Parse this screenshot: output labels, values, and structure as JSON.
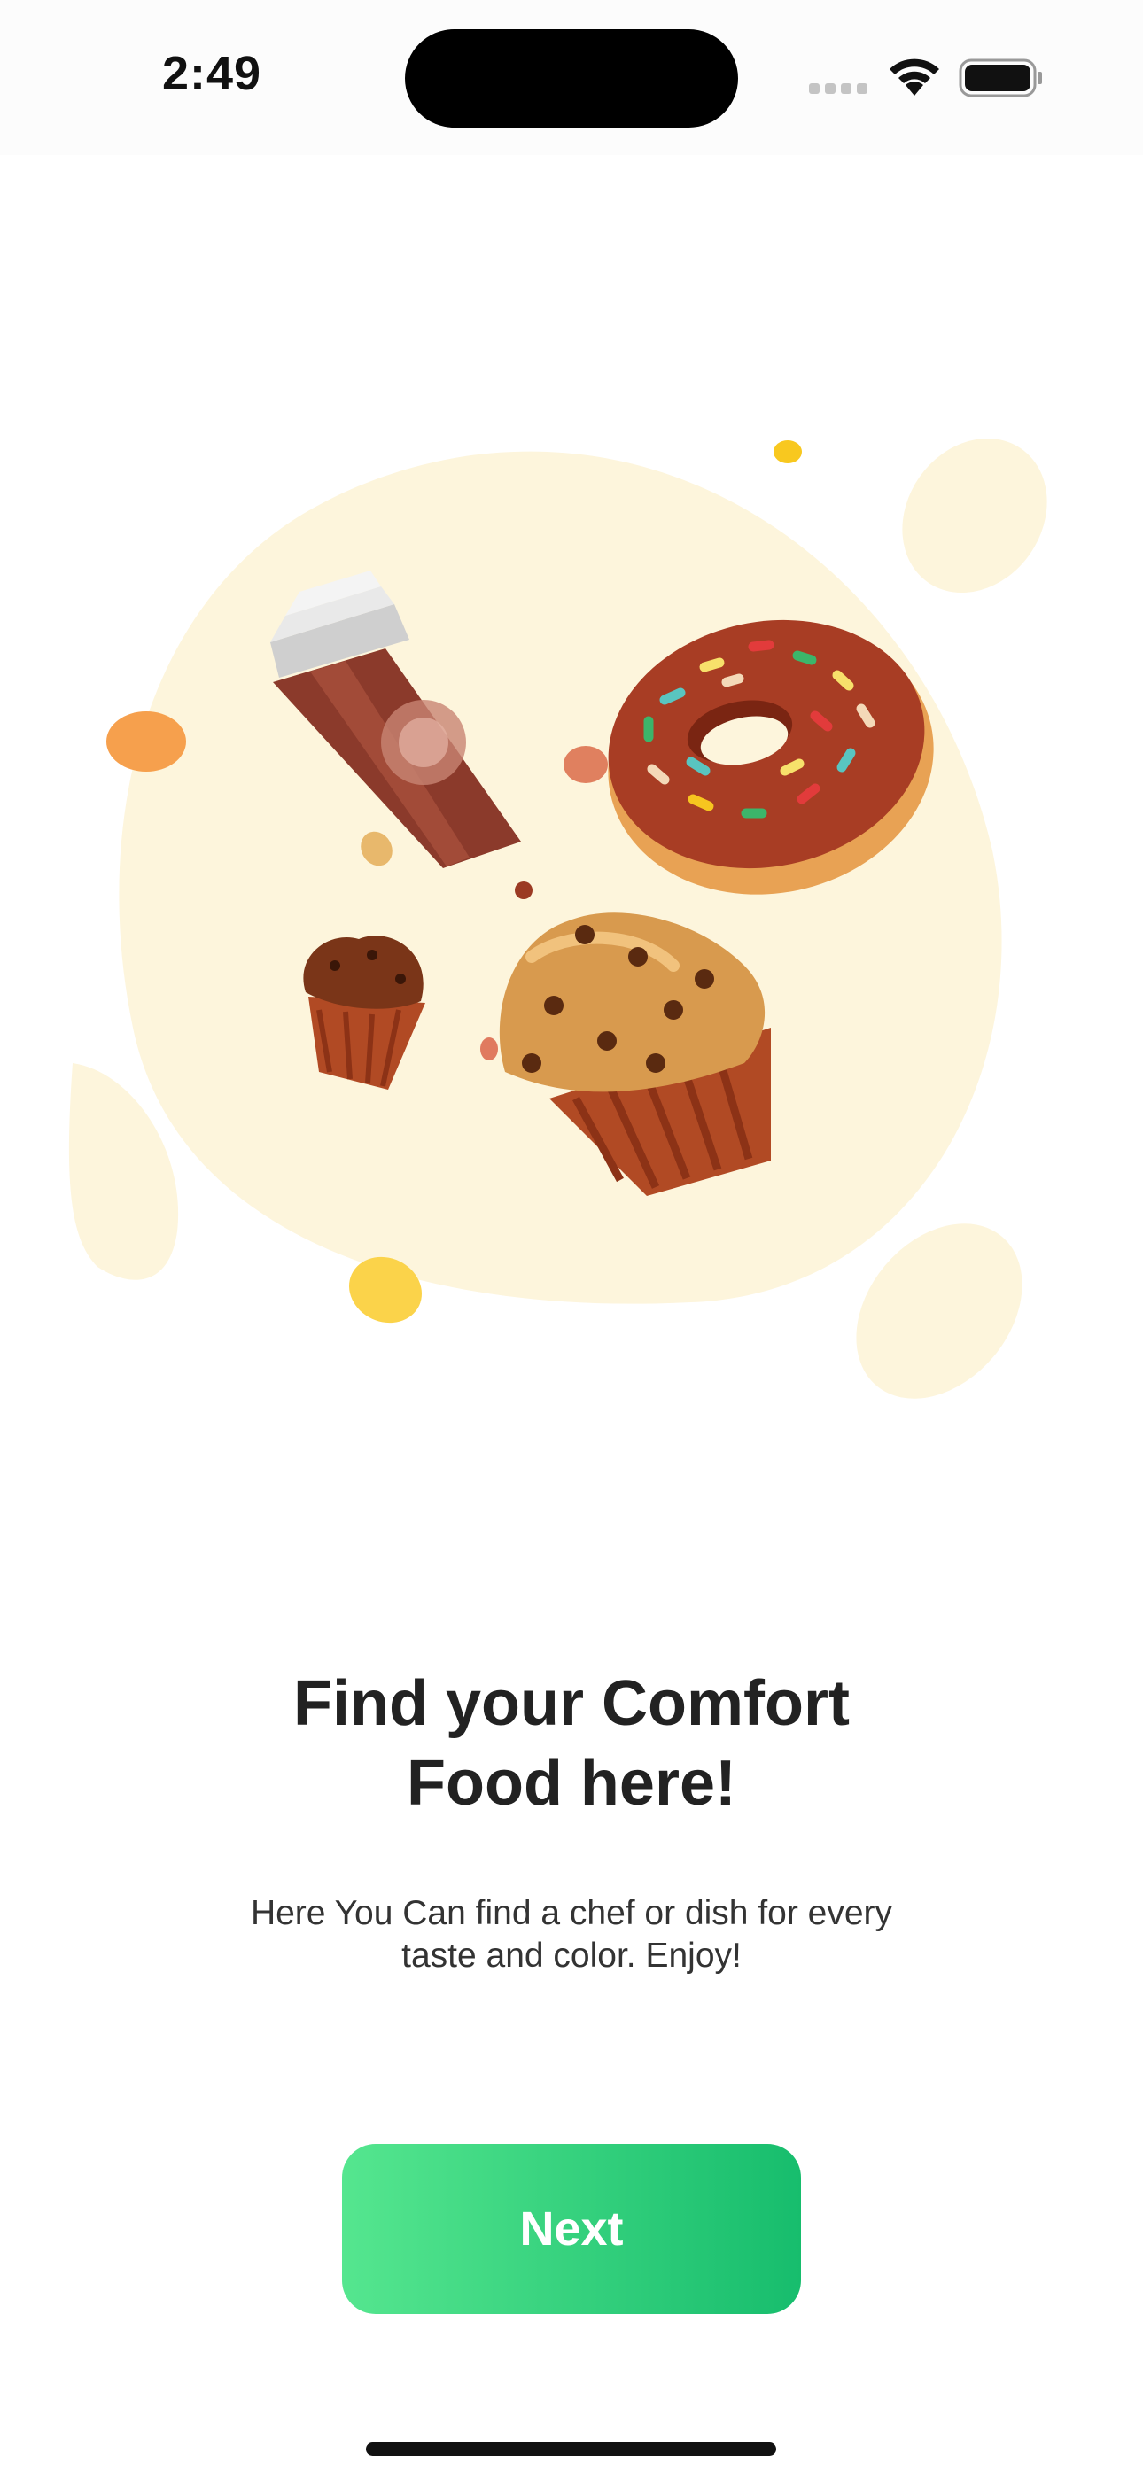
{
  "status_bar": {
    "time": "2:49",
    "icons": [
      "cellular-signal-icon",
      "wifi-icon",
      "battery-icon"
    ]
  },
  "illustration": {
    "subject": "coffee cup, sprinkled donut and muffins",
    "colors": {
      "blob": "#fdf5dc",
      "coffee": "#8b3a2b",
      "donut_icing": "#a83d24",
      "muffin": "#d89a4e"
    }
  },
  "onboarding": {
    "title_line1": "Find your Comfort",
    "title_line2": "Food here!",
    "subtitle_line1": "Here You Can find a chef or dish for every",
    "subtitle_line2": "taste and color. Enjoy!",
    "next_label": "Next"
  },
  "colors": {
    "accent_start": "#55e68f",
    "accent_end": "#17bd6d",
    "text": "#222222"
  }
}
